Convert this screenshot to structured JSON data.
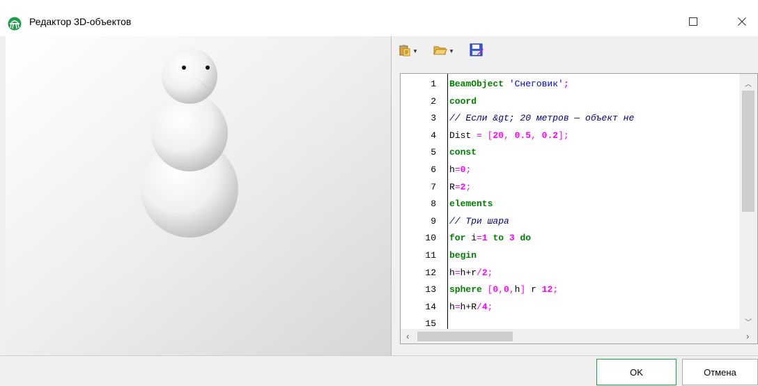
{
  "window": {
    "title": "Редактор 3D-объектов",
    "icon": "snowman-app-icon",
    "maximize_icon": "maximize-icon",
    "close_icon": "close-icon"
  },
  "toolbar": {
    "items": [
      {
        "name": "paste-template-button",
        "icon": "clipboard-icon",
        "has_dropdown": true
      },
      {
        "name": "open-file-button",
        "icon": "folder-open-icon",
        "has_dropdown": true
      },
      {
        "name": "save-file-button",
        "icon": "save-icon",
        "has_dropdown": false
      }
    ]
  },
  "viewport": {
    "scene": "snowman-3d-preview"
  },
  "editor": {
    "lines": [
      {
        "n": "1",
        "tokens": [
          [
            "kw",
            "BeamObject "
          ],
          [
            "str",
            "'Снеговик'"
          ],
          [
            "num",
            ";"
          ]
        ]
      },
      {
        "n": "2",
        "tokens": [
          [
            "kw",
            "coord"
          ]
        ]
      },
      {
        "n": "3",
        "tokens": [
          [
            "cm",
            "// Если &gt; 20 метров — объект не"
          ]
        ]
      },
      {
        "n": "4",
        "tokens": [
          [
            "id",
            "Dist "
          ],
          [
            "pn",
            "= ["
          ],
          [
            "num",
            "20"
          ],
          [
            "pn",
            ", "
          ],
          [
            "num",
            "0.5"
          ],
          [
            "pn",
            ", "
          ],
          [
            "num",
            "0.2"
          ],
          [
            "pn",
            "];"
          ]
        ]
      },
      {
        "n": "5",
        "tokens": [
          [
            "kw",
            "const"
          ]
        ]
      },
      {
        "n": "6",
        "tokens": [
          [
            "id",
            "h"
          ],
          [
            "pn",
            "="
          ],
          [
            "num",
            "0"
          ],
          [
            "pn",
            ";"
          ]
        ]
      },
      {
        "n": "7",
        "tokens": [
          [
            "id",
            "R"
          ],
          [
            "pn",
            "="
          ],
          [
            "num",
            "2"
          ],
          [
            "pn",
            ";"
          ]
        ]
      },
      {
        "n": "8",
        "tokens": [
          [
            "kw",
            "elements"
          ]
        ]
      },
      {
        "n": "9",
        "tokens": [
          [
            "cm",
            "// Три шара"
          ]
        ]
      },
      {
        "n": "10",
        "tokens": [
          [
            "kw",
            "for "
          ],
          [
            "id",
            "i"
          ],
          [
            "pn",
            "="
          ],
          [
            "num",
            "1"
          ],
          [
            "id",
            " "
          ],
          [
            "kw",
            "to "
          ],
          [
            "num",
            "3"
          ],
          [
            "id",
            " "
          ],
          [
            "kw",
            "do"
          ]
        ]
      },
      {
        "n": "11",
        "tokens": [
          [
            "kw",
            "begin"
          ]
        ]
      },
      {
        "n": "12",
        "tokens": [
          [
            "id",
            "h"
          ],
          [
            "pn",
            "="
          ],
          [
            "id",
            "h+r"
          ],
          [
            "pn",
            "/"
          ],
          [
            "num",
            "2"
          ],
          [
            "pn",
            ";"
          ]
        ]
      },
      {
        "n": "13",
        "tokens": [
          [
            "kw",
            "sphere "
          ],
          [
            "pn",
            "["
          ],
          [
            "num",
            "0"
          ],
          [
            "pn",
            ","
          ],
          [
            "num",
            "0"
          ],
          [
            "pn",
            ","
          ],
          [
            "id",
            "h"
          ],
          [
            "pn",
            "]"
          ],
          [
            "id",
            " r "
          ],
          [
            "num",
            "12"
          ],
          [
            "pn",
            ";"
          ]
        ]
      },
      {
        "n": "14",
        "tokens": [
          [
            "id",
            "h"
          ],
          [
            "pn",
            "="
          ],
          [
            "id",
            "h+R"
          ],
          [
            "pn",
            "/"
          ],
          [
            "num",
            "4"
          ],
          [
            "pn",
            ";"
          ]
        ]
      },
      {
        "n": "15",
        "tokens": []
      }
    ]
  },
  "buttons": {
    "ok_label": "OK",
    "cancel_label": "Отмена"
  },
  "colors": {
    "keyword": "#008000",
    "string": "#0000ff",
    "comment": "#000080",
    "number": "#ff00ff"
  }
}
